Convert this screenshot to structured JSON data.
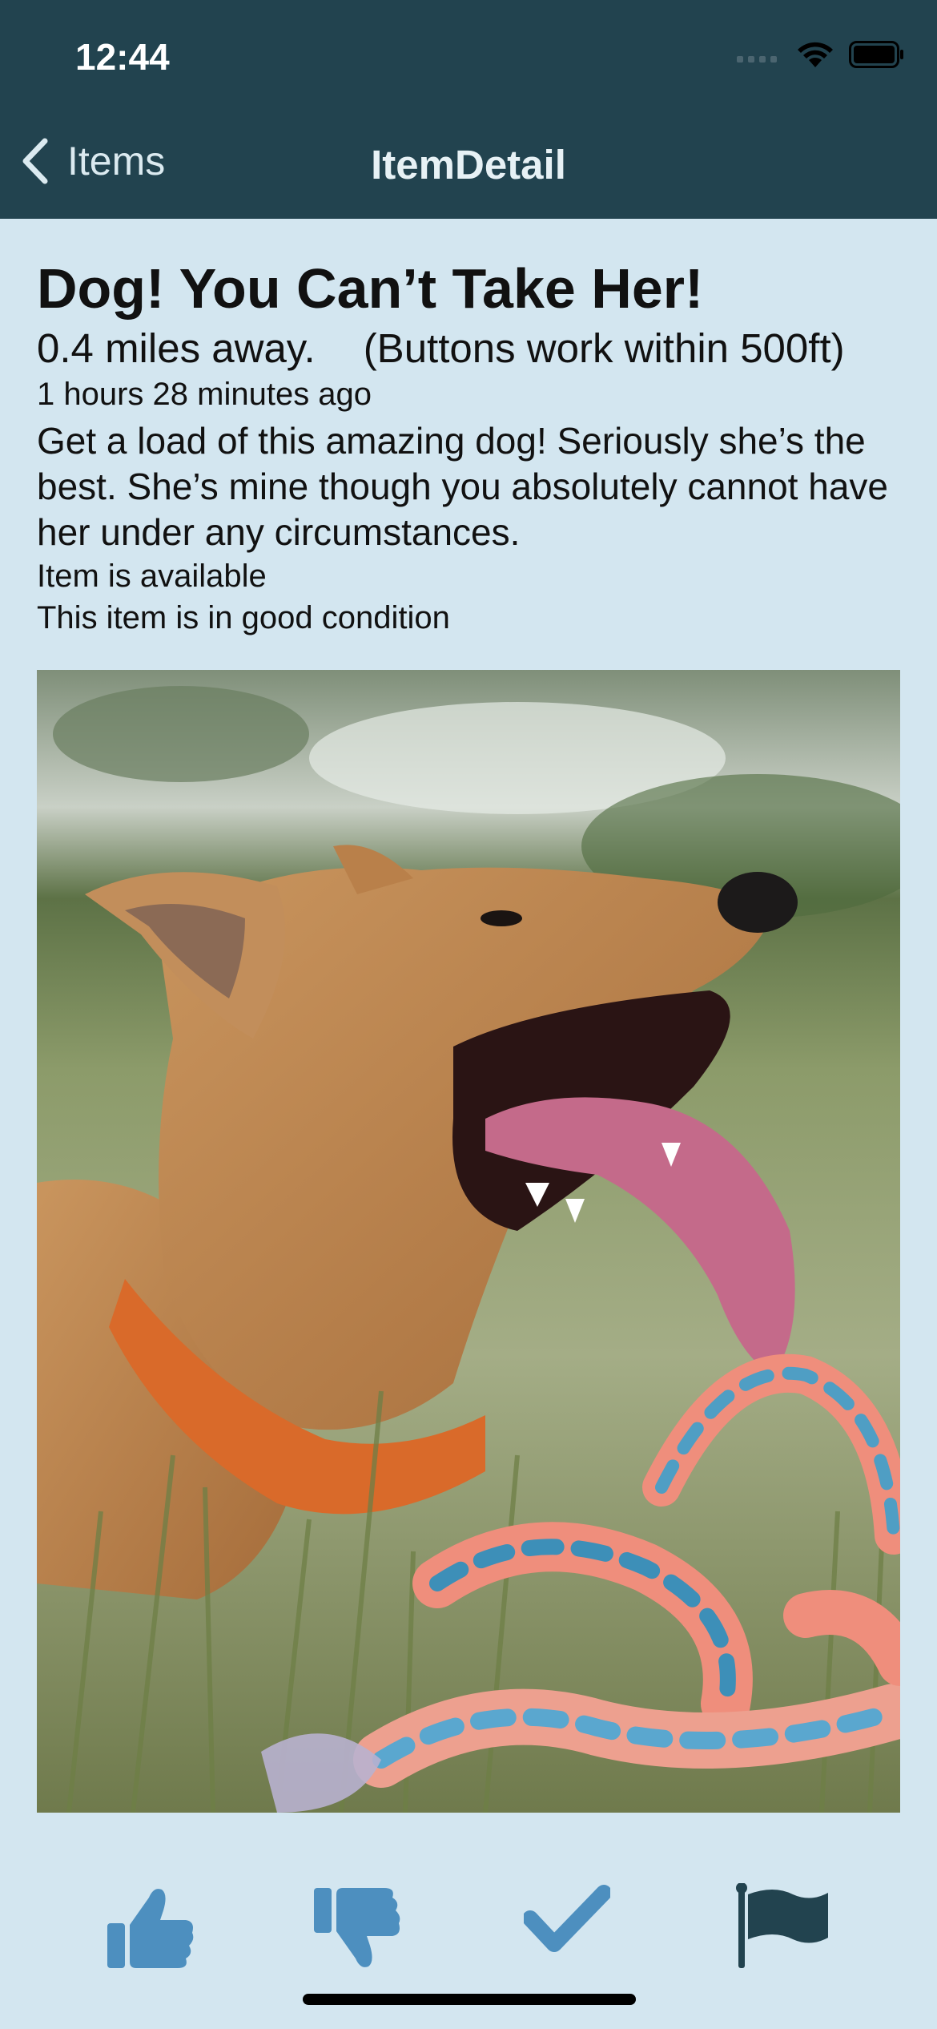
{
  "status_bar": {
    "time": "12:44"
  },
  "nav": {
    "back_label": "Items",
    "title": "ItemDetail"
  },
  "item": {
    "title": "Dog! You Can’t Take Her!",
    "distance": "0.4 miles away.",
    "button_note": "(Buttons work within 500ft)",
    "posted": "1 hours 28 minutes ago",
    "description": "Get a load of this amazing dog! Seriously she’s the best. She’s mine though you absolutely cannot have her under any circumstances.",
    "availability": "Item is available",
    "condition": "This item is in good condition"
  },
  "actions": [
    {
      "icon": "thumbs-up-icon",
      "color": "#4d8fbf"
    },
    {
      "icon": "thumbs-down-icon",
      "color": "#4d8fbf"
    },
    {
      "icon": "checkmark-icon",
      "color": "#4d8fbf"
    },
    {
      "icon": "flag-icon",
      "color": "#22434f"
    }
  ],
  "colors": {
    "header": "#22434f",
    "background": "#d3e6f0",
    "accent": "#4d8fbf"
  }
}
